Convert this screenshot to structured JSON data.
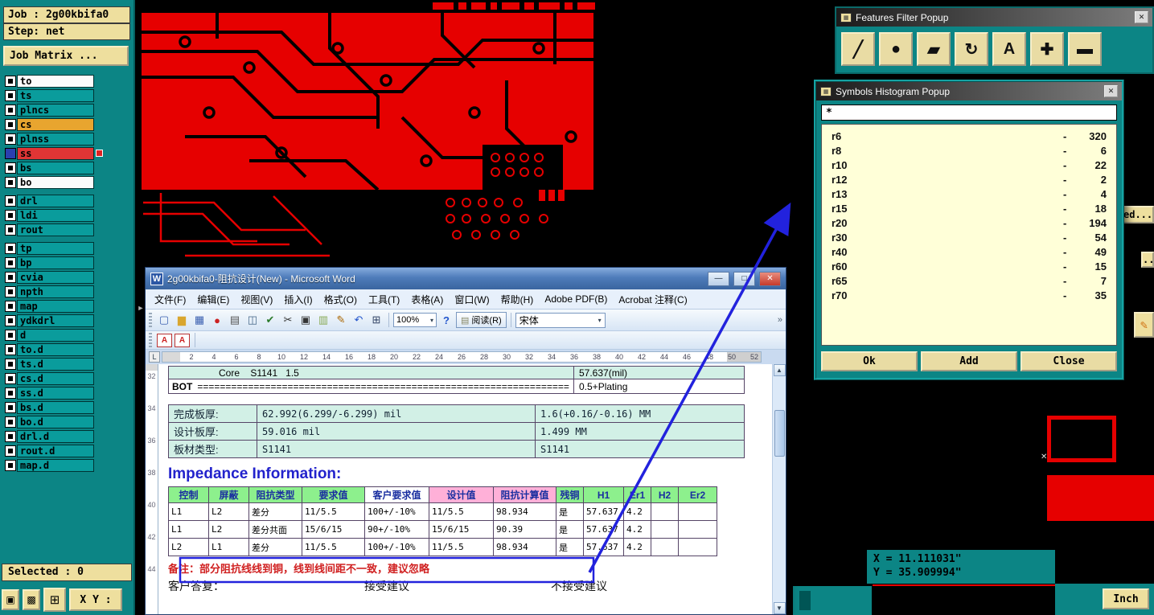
{
  "ui": {
    "minimize_glyph": "—",
    "maximize_glyph": "□",
    "close_glyph": "✕",
    "dropdown_glyph": "▾",
    "up_glyph": "▲",
    "down_glyph": "▼",
    "overflow_glyph": "»"
  },
  "sidebar": {
    "job": "Job : 2g00kbifa0",
    "step": "Step: net",
    "job_matrix": "Job Matrix ...",
    "groups": [
      {
        "layers": [
          {
            "name": "to",
            "variant": "white"
          },
          {
            "name": "ts",
            "variant": "teal"
          },
          {
            "name": "plncs",
            "variant": "teal"
          },
          {
            "name": "cs",
            "variant": "orange"
          },
          {
            "name": "plnss",
            "variant": "teal"
          },
          {
            "name": "ss",
            "variant": "red",
            "flagv": "flag"
          },
          {
            "name": "bs",
            "variant": "teal"
          },
          {
            "name": "bo",
            "variant": "white"
          }
        ]
      },
      {
        "layers": [
          {
            "name": "drl",
            "variant": "teal"
          },
          {
            "name": "ldi",
            "variant": "teal"
          },
          {
            "name": "rout",
            "variant": "teal"
          }
        ]
      },
      {
        "layers": [
          {
            "name": "tp",
            "variant": "teal"
          },
          {
            "name": "bp",
            "variant": "teal"
          },
          {
            "name": "cvia",
            "variant": "teal"
          },
          {
            "name": "npth",
            "variant": "teal"
          },
          {
            "name": "map",
            "variant": "teal"
          },
          {
            "name": "ydkdrl",
            "variant": "teal"
          },
          {
            "name": "d",
            "variant": "teal"
          },
          {
            "name": "to.d",
            "variant": "teal"
          },
          {
            "name": "ts.d",
            "variant": "teal"
          },
          {
            "name": "cs.d",
            "variant": "teal"
          },
          {
            "name": "ss.d",
            "variant": "teal"
          },
          {
            "name": "bs.d",
            "variant": "teal"
          },
          {
            "name": "bo.d",
            "variant": "teal"
          },
          {
            "name": "drl.d",
            "variant": "teal"
          },
          {
            "name": "rout.d",
            "variant": "teal"
          },
          {
            "name": "map.d",
            "variant": "teal"
          }
        ]
      }
    ],
    "selected": "Selected : 0",
    "xy_button": "X Y :"
  },
  "word": {
    "title": "2g00kbifa0-阻抗设计(New) - Microsoft Word",
    "menus": [
      "文件(F)",
      "编辑(E)",
      "视图(V)",
      "插入(I)",
      "格式(O)",
      "工具(T)",
      "表格(A)",
      "窗口(W)",
      "帮助(H)",
      "Adobe PDF(B)",
      "Acrobat 注释(C)"
    ],
    "toolbar": {
      "icons": [
        {
          "name": "new-document-icon",
          "glyph": "▢",
          "color": "#3a5fb0"
        },
        {
          "name": "open-folder-icon",
          "glyph": "▆",
          "color": "#d9a62e"
        },
        {
          "name": "save-icon",
          "glyph": "▦",
          "color": "#3a5fb0"
        },
        {
          "name": "permission-icon",
          "glyph": "●",
          "color": "#cc2222"
        },
        {
          "name": "print-icon",
          "glyph": "▤",
          "color": "#555555"
        },
        {
          "name": "print-preview-icon",
          "glyph": "◫",
          "color": "#446688"
        },
        {
          "name": "spelling-icon",
          "glyph": "✔",
          "color": "#2a7a2a"
        },
        {
          "name": "cut-icon",
          "glyph": "✂",
          "color": "#333333"
        },
        {
          "name": "copy-icon",
          "glyph": "▣",
          "color": "#333333"
        },
        {
          "name": "paste-icon",
          "glyph": "▥",
          "color": "#88aa55"
        },
        {
          "name": "format-painter-icon",
          "glyph": "✎",
          "color": "#aa6600"
        },
        {
          "name": "undo-icon",
          "glyph": "↶",
          "color": "#2255cc"
        },
        {
          "name": "insert-table-icon",
          "glyph": "⊞",
          "color": "#334466"
        }
      ],
      "zoom": "100%",
      "help": "?",
      "read": "阅读(R)",
      "font": "宋体",
      "pdf_icons": [
        {
          "name": "convert-to-pdf-icon",
          "glyph": "A"
        },
        {
          "name": "pdf-email-icon",
          "glyph": "A"
        }
      ]
    },
    "ruler_h": [
      "2",
      "4",
      "6",
      "8",
      "10",
      "12",
      "14",
      "16",
      "18",
      "20",
      "22",
      "24",
      "26",
      "28",
      "30",
      "32",
      "34",
      "36",
      "38",
      "40",
      "42",
      "44",
      "46",
      "48",
      "50",
      "52"
    ],
    "ruler_v": [
      "32",
      "34",
      "36",
      "38",
      "40",
      "42",
      "44"
    ],
    "doc": {
      "stackup": {
        "core_left": "Core    S1141   1.5",
        "core_right": "57.637(mil)",
        "bot_label": "BOT",
        "bot_fill": "==================================================================",
        "bot_right": "0.5+Plating"
      },
      "board": [
        {
          "label": "完成板厚:",
          "mil": "62.992(6.299/-6.299) mil",
          "mm": "1.6(+0.16/-0.16) MM"
        },
        {
          "label": "设计板厚:",
          "mil": "59.016 mil",
          "mm": "1.499 MM"
        },
        {
          "label": "板材类型:",
          "mil": "S1141",
          "mm": "S1141"
        }
      ],
      "impedance_title": "Impedance Information:",
      "imp_headers": [
        {
          "label": "控制",
          "variant": "green"
        },
        {
          "label": "屏蔽",
          "variant": "green"
        },
        {
          "label": "阻抗类型",
          "variant": "green"
        },
        {
          "label": "要求值",
          "variant": "green"
        },
        {
          "label": "客户要求值",
          "variant": "plain"
        },
        {
          "label": "设计值",
          "variant": "pink"
        },
        {
          "label": "阻抗计算值",
          "variant": "pink"
        },
        {
          "label": "残铜",
          "variant": "green"
        },
        {
          "label": "H1",
          "variant": "green"
        },
        {
          "label": "Er1",
          "variant": "green"
        },
        {
          "label": "H2",
          "variant": "green"
        },
        {
          "label": "Er2",
          "variant": "green"
        }
      ],
      "imp_rows": [
        [
          "L1",
          "L2",
          "差分",
          "11/5.5",
          "100+/-10%",
          "11/5.5",
          "98.934",
          "是",
          "57.637",
          "4.2",
          "",
          ""
        ],
        [
          "L1",
          "L2",
          "差分共面",
          "15/6/15",
          "90+/-10%",
          "15/6/15",
          "90.39",
          "是",
          "57.637",
          "4.2",
          "",
          ""
        ],
        [
          "L2",
          "L1",
          "差分",
          "11/5.5",
          "100+/-10%",
          "11/5.5",
          "98.934",
          "是",
          "57.637",
          "4.2",
          "",
          ""
        ]
      ],
      "note": "备注：部分阻抗线线到铜，线到线间距不一致，建议忽略",
      "reply_label": "客户答复：",
      "accept_label": "接受建议",
      "reject_label": "不接受建议"
    }
  },
  "features_filter": {
    "title": "Features Filter Popup",
    "tools": [
      {
        "name": "line-tool-icon",
        "glyph": "╱"
      },
      {
        "name": "pad-tool-icon",
        "glyph": "●"
      },
      {
        "name": "surface-tool-icon",
        "glyph": "▰"
      },
      {
        "name": "arc-tool-icon",
        "glyph": "↻"
      },
      {
        "name": "text-tool-icon",
        "glyph": "A"
      },
      {
        "name": "positive-tool-icon",
        "glyph": "✚"
      },
      {
        "name": "negative-tool-icon",
        "glyph": "▬"
      }
    ]
  },
  "histogram": {
    "title": "Symbols Histogram Popup",
    "filter_value": "*",
    "dash": "-",
    "items": [
      {
        "name": "r6",
        "count": 320
      },
      {
        "name": "r8",
        "count": 6
      },
      {
        "name": "r10",
        "count": 22
      },
      {
        "name": "r12",
        "count": 2
      },
      {
        "name": "r13",
        "count": 4
      },
      {
        "name": "r15",
        "count": 18
      },
      {
        "name": "r20",
        "count": 194
      },
      {
        "name": "r30",
        "count": 54
      },
      {
        "name": "r40",
        "count": 49
      },
      {
        "name": "r60",
        "count": 15
      },
      {
        "name": "r65",
        "count": 7
      },
      {
        "name": "r70",
        "count": 35
      }
    ],
    "ok": "Ok",
    "add": "Add",
    "close": "Close"
  },
  "status": {
    "x_readout": "X = 11.111031\"",
    "y_readout": "Y = 35.909994\"",
    "units_button": "Inch"
  },
  "fragments": {
    "obscured_button": "ed...",
    "dots_button": "...",
    "expand_handle": "►"
  }
}
